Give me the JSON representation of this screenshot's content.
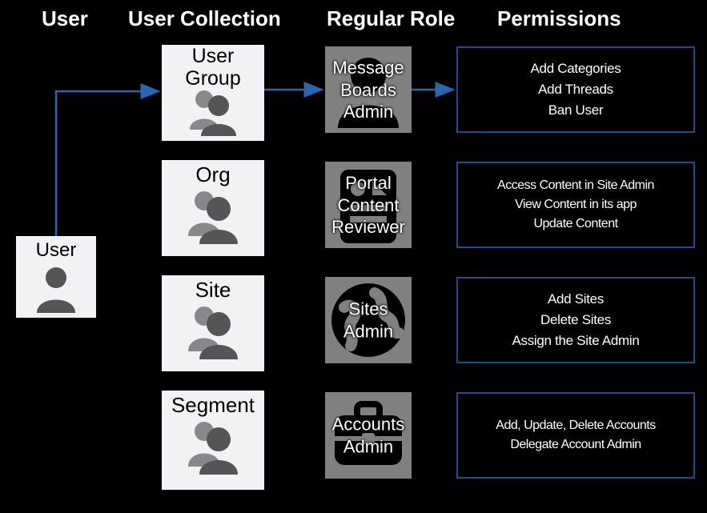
{
  "headers": {
    "user": "User",
    "collection": "User Collection",
    "role": "Regular Role",
    "permissions": "Permissions"
  },
  "user_node": {
    "label": "User"
  },
  "collections": [
    {
      "label": "User\nGroup"
    },
    {
      "label": "Org"
    },
    {
      "label": "Site"
    },
    {
      "label": "Segment"
    }
  ],
  "roles": [
    {
      "label": "Message\nBoards\nAdmin"
    },
    {
      "label": "Portal\nContent\nReviewer"
    },
    {
      "label": "Sites\nAdmin"
    },
    {
      "label": "Accounts\nAdmin"
    }
  ],
  "permissions": [
    [
      "Add Categories",
      "Add Threads",
      "Ban User"
    ],
    [
      "Access Content in Site Admin",
      "View Content in its app",
      "Update Content"
    ],
    [
      "Add Sites",
      "Delete Sites",
      "Assign the Site Admin"
    ],
    [
      "Add, Update, Delete Accounts",
      "Delegate Account Admin"
    ]
  ]
}
